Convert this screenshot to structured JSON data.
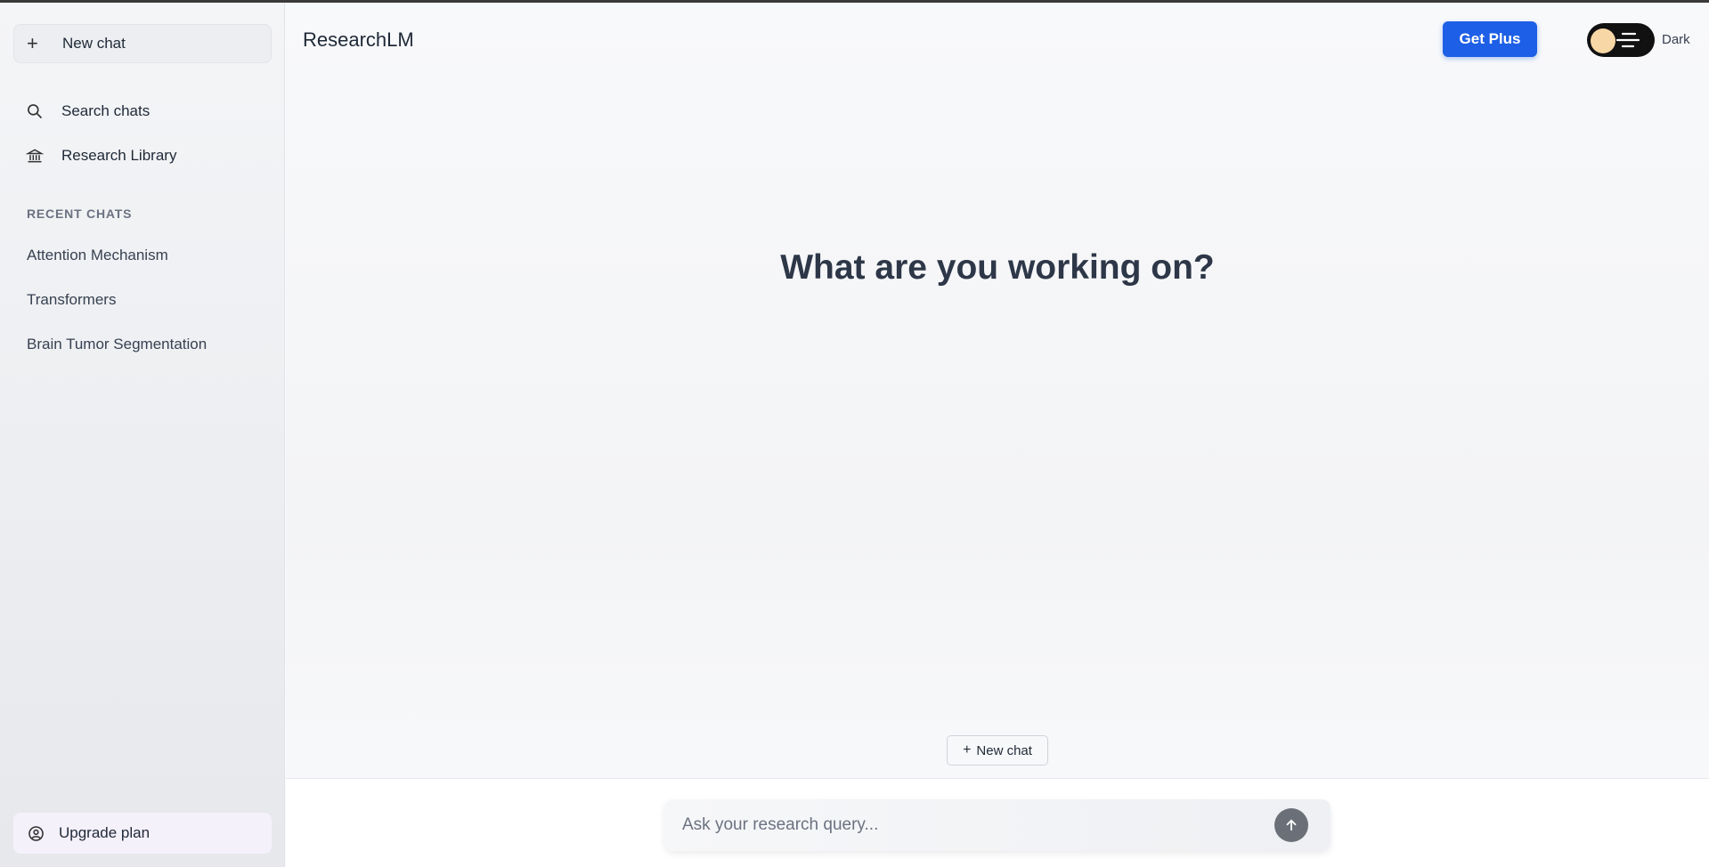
{
  "sidebar": {
    "new_chat_label": "New chat",
    "search_label": "Search chats",
    "library_label": "Research Library",
    "recent_heading": "RECENT CHATS",
    "recent_chats": [
      "Attention Mechanism",
      "Transformers",
      "Brain Tumor Segmentation"
    ],
    "upgrade_label": "Upgrade plan"
  },
  "header": {
    "brand": "ResearchLM",
    "get_plus_label": "Get Plus",
    "theme_label": "Dark"
  },
  "main": {
    "hero_title": "What are you working on?",
    "new_chat_small_label": "New chat"
  },
  "composer": {
    "placeholder": "Ask your research query..."
  },
  "colors": {
    "accent": "#1d5fe6",
    "toggle_bg": "#111111",
    "toggle_knob": "#f8d7a6",
    "send_button": "#6b7078"
  },
  "icons": {
    "new_chat": "plus-icon",
    "search": "search-icon",
    "library": "library-icon",
    "upgrade": "user-circle-icon",
    "send": "arrow-up-icon"
  }
}
